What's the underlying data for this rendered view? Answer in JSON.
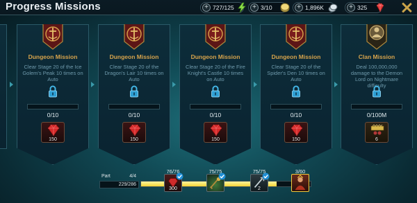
{
  "header": {
    "title": "Progress Missions",
    "resources": [
      {
        "icon": "energy-icon",
        "value": "727/125"
      },
      {
        "icon": "silver-coin-icon",
        "value": "3/10"
      },
      {
        "icon": "silver-icon",
        "value": "1,896K"
      },
      {
        "icon": "gem-icon",
        "value": "325"
      }
    ]
  },
  "cards": [
    {
      "title": "Dungeon Mission",
      "description": "Clear Stage 20 of the Ice Golem's Peak 10 times on Auto",
      "progress": "0/10",
      "reward_count": "150",
      "emblem": "dungeon-emblem-icon",
      "reward_icon": "ruby-reward-icon"
    },
    {
      "title": "Dungeon Mission",
      "description": "Clear Stage 20 of the Dragon's Lair 10 times on Auto",
      "progress": "0/10",
      "reward_count": "150",
      "emblem": "dungeon-emblem-icon",
      "reward_icon": "ruby-reward-icon"
    },
    {
      "title": "Dungeon Mission",
      "description": "Clear Stage 20 of the Fire Knight's Castle 10 times on Auto",
      "progress": "0/10",
      "reward_count": "150",
      "emblem": "dungeon-emblem-icon",
      "reward_icon": "ruby-reward-icon"
    },
    {
      "title": "Dungeon Mission",
      "description": "Clear Stage 20 of the Spider's Den 10 times on Auto",
      "progress": "0/10",
      "reward_count": "150",
      "emblem": "dungeon-emblem-icon",
      "reward_icon": "ruby-reward-icon"
    },
    {
      "title": "Clan Mission",
      "description": "Deal 100,000,000 damage to the Demon Lord on Nightmare difficulty",
      "progress": "0/100M",
      "reward_count": "6",
      "emblem": "clan-emblem-icon",
      "reward_icon": "clan-chest-reward-icon"
    }
  ],
  "footer": {
    "part_label": "Part",
    "part_value": "4/4",
    "points": "229/286",
    "fill_fraction": 0.8,
    "milestones": [
      {
        "label": "76/76",
        "count": "300",
        "claimed": true
      },
      {
        "label": "75/75",
        "count": "",
        "claimed": true
      },
      {
        "label": "75/75",
        "count": "2",
        "claimed": true
      },
      {
        "label": "3/60",
        "count": "",
        "claimed": false
      }
    ]
  },
  "colors": {
    "accent_gold": "#d6a34c",
    "progress_yellow": "#f3d536",
    "panel_bg": "#0d2d3a"
  }
}
